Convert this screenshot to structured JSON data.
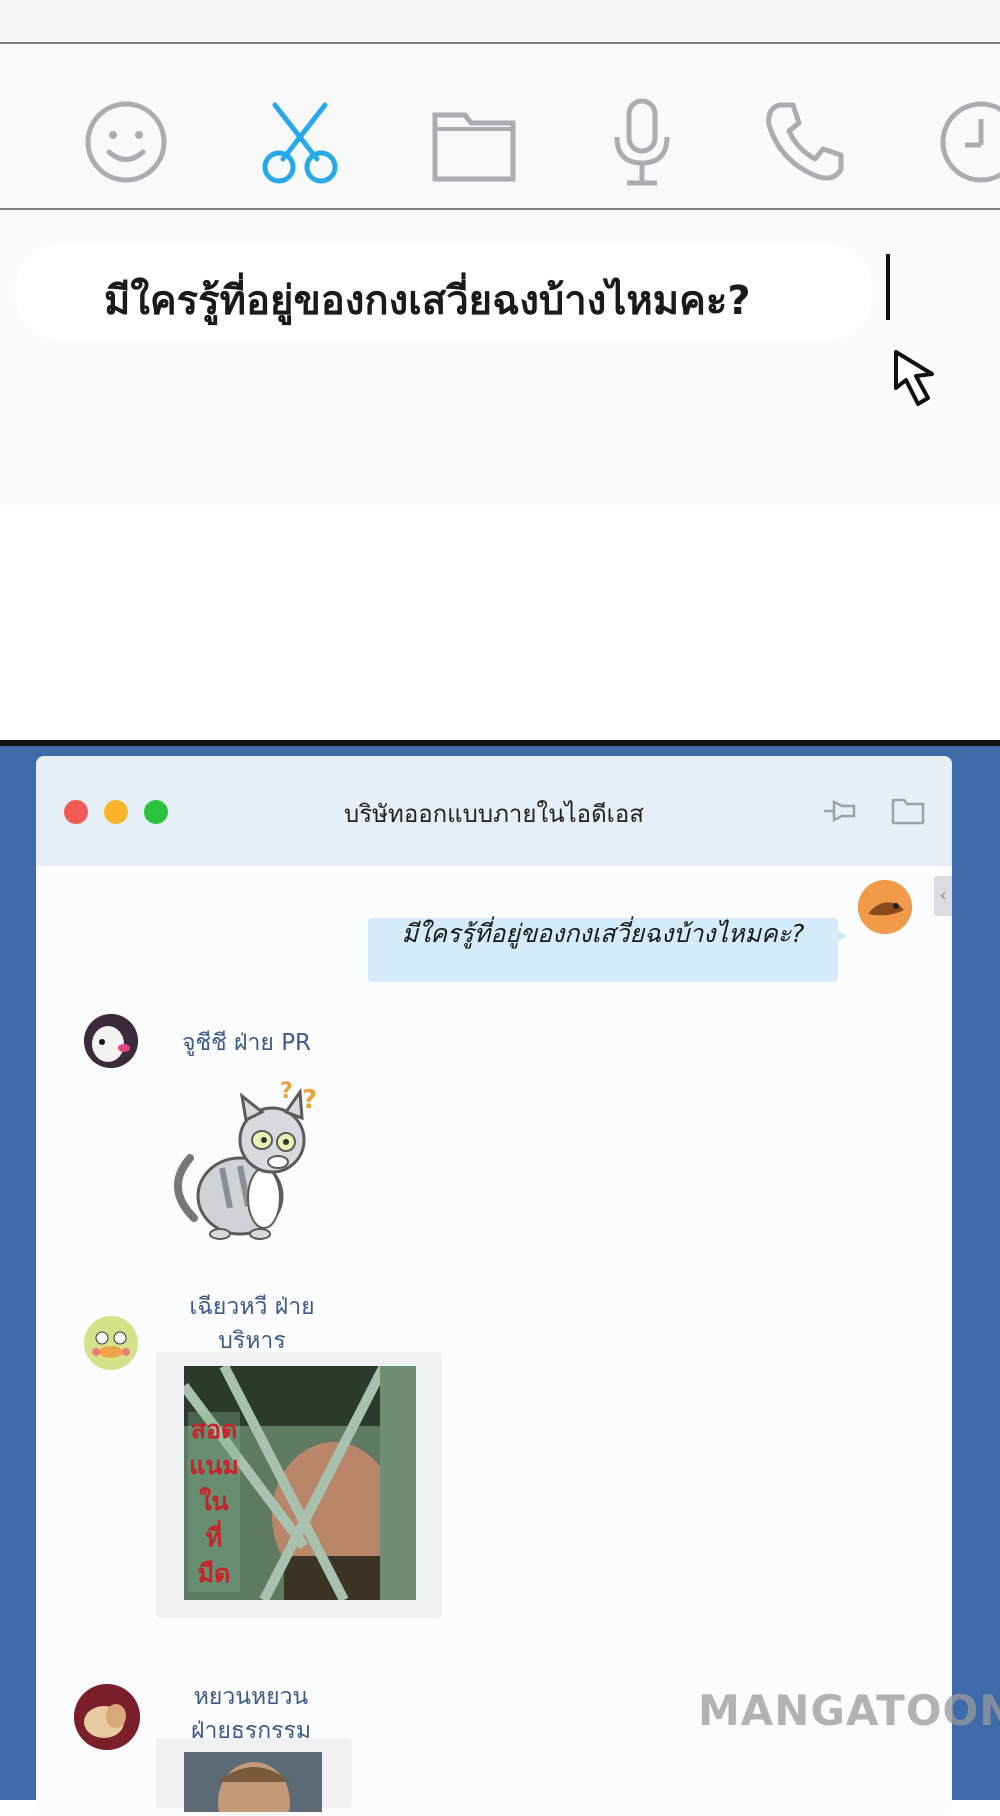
{
  "composer": {
    "toolbar_icons": [
      "smiley-icon",
      "scissors-icon",
      "folder-icon",
      "microphone-icon",
      "phone-icon",
      "clock-icon"
    ],
    "active_icon": "scissors-icon",
    "active_color": "#27a9e8",
    "icon_color": "#a9adb2",
    "draft_text": "มีใครรู้ที่อยู่ของกงเสวี่ยฉงบ้างไหมคะ?"
  },
  "window": {
    "title": "บริษัทออกแบบภายในไอดีเอส",
    "traffic_lights": [
      "#f25a55",
      "#f7b52c",
      "#2bc240"
    ],
    "titlebar_icons": [
      "pin-icon",
      "folder-icon"
    ]
  },
  "messages": [
    {
      "from": "self",
      "text": "มีใครรู้ที่อยู่ของกงเสวี่ยฉงบ้างไหมคะ?"
    },
    {
      "from": "other",
      "sender": "จูชีชี ฝ่าย PR",
      "content": "cat-sticker"
    },
    {
      "from": "other",
      "sender_line1": "เฉียวหวี ฝ่าย",
      "sender_line2": "บริหาร",
      "content": "image",
      "overlay_lines": [
        "สอด",
        "แนม",
        "ใน",
        "ที่",
        "มืด"
      ]
    },
    {
      "from": "other",
      "sender_line1": "หยวนหยวน",
      "sender_line2": "ฝ่ายธุรกรรม",
      "content": "image"
    }
  ],
  "watermark": "MANGATOON"
}
